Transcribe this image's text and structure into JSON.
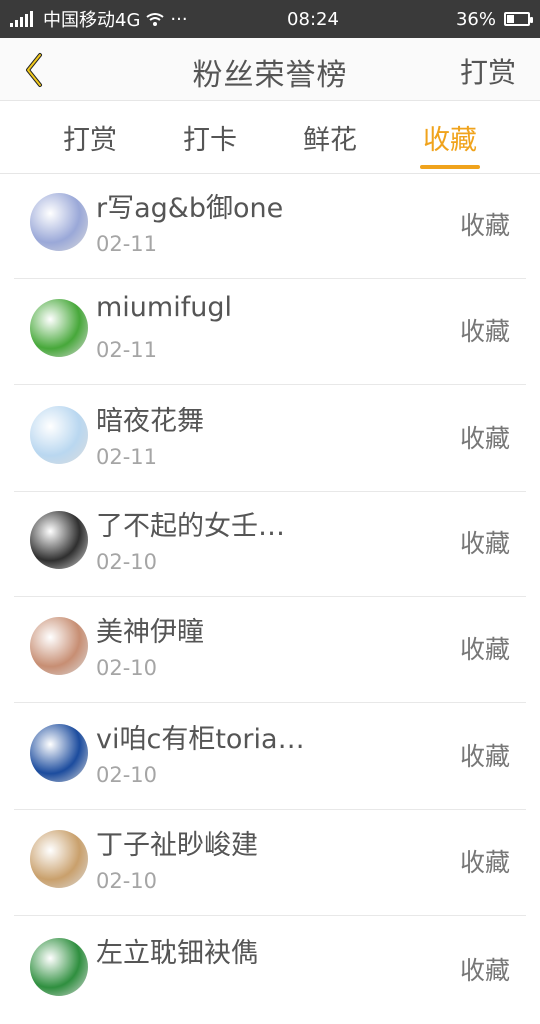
{
  "status_bar": {
    "carrier": "中国移动4G",
    "dots": "···",
    "time": "08:24",
    "battery": "36%",
    "battery_level": 0.36
  },
  "navbar": {
    "title": "粉丝荣誉榜",
    "right_label": "打赏",
    "back_icon": "chevron-left-icon",
    "accent": "#f0a31c"
  },
  "tabs": [
    {
      "label": "打赏"
    },
    {
      "label": "打卡"
    },
    {
      "label": "鲜花"
    },
    {
      "label": "收藏"
    }
  ],
  "active_tab_color": "#f0a31c",
  "list": {
    "items": [
      {
        "name": "r写ag&b御one",
        "date": "02-11",
        "action": "收藏",
        "avatar_color": "#9aa8d8"
      },
      {
        "name": "miumifugl",
        "date": "02-11",
        "action": "收藏",
        "avatar_color": "#47a83a"
      },
      {
        "name": "暗夜花舞",
        "date": "02-11",
        "action": "收藏",
        "avatar_color": "#b9d7f0"
      },
      {
        "name": "了不起的女壬…",
        "date": "02-10",
        "action": "收藏",
        "avatar_color": "#2f2f2f"
      },
      {
        "name": "美神伊瞳",
        "date": "02-10",
        "action": "收藏",
        "avatar_color": "#c78e73"
      },
      {
        "name": "vi咱c有柜toria…",
        "date": "02-10",
        "action": "收藏",
        "avatar_color": "#1c4c9e"
      },
      {
        "name": "丁子祉眇峻建",
        "date": "02-10",
        "action": "收藏",
        "avatar_color": "#c9a06c"
      },
      {
        "name": "左立耽钿袂儁",
        "date": "",
        "action": "收藏",
        "avatar_color": "#2f8f3f"
      }
    ]
  }
}
